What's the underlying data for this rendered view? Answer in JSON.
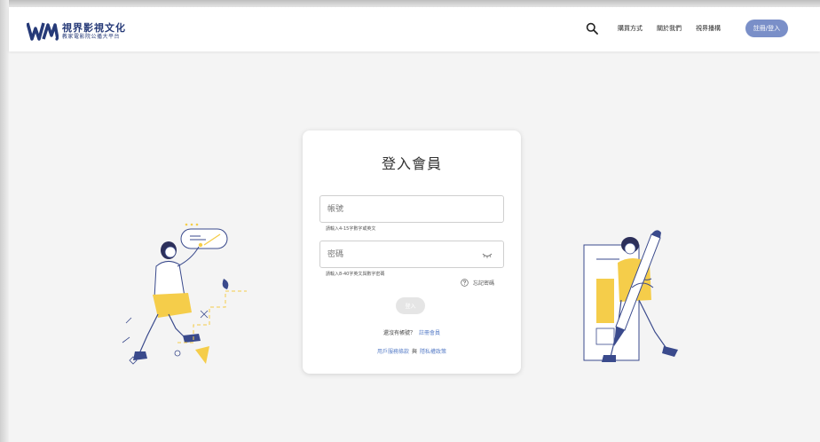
{
  "header": {
    "logo_title": "視界影視文化",
    "logo_subtitle": "教家電影院公播大平台",
    "nav": {
      "purchase": "購買方式",
      "about": "關於我們",
      "broadcast": "視界播構",
      "login_register": "註冊/登入"
    }
  },
  "card": {
    "title": "登入會員",
    "username": {
      "placeholder": "帳號",
      "value": "",
      "hint": "請輸入4-15字數字或英文"
    },
    "password": {
      "placeholder": "密碼",
      "value": "",
      "hint": "請輸入8-40字英文與數字密碼"
    },
    "forgot_password": "忘記密碼",
    "submit_label": "登入",
    "no_account": "還沒有帳號？",
    "register_link": "註冊會員",
    "terms_link": "用戶服務條款",
    "and": "與",
    "privacy_link": "隱私權政策"
  },
  "colors": {
    "brand_navy": "#263a78",
    "accent_button": "#7a8fc8",
    "link_blue": "#5a7fc8",
    "illustration_yellow": "#f5cd4a",
    "illustration_navy": "#3a4a8c"
  },
  "icons": [
    "search-icon",
    "eye-closed-icon",
    "help-icon"
  ]
}
